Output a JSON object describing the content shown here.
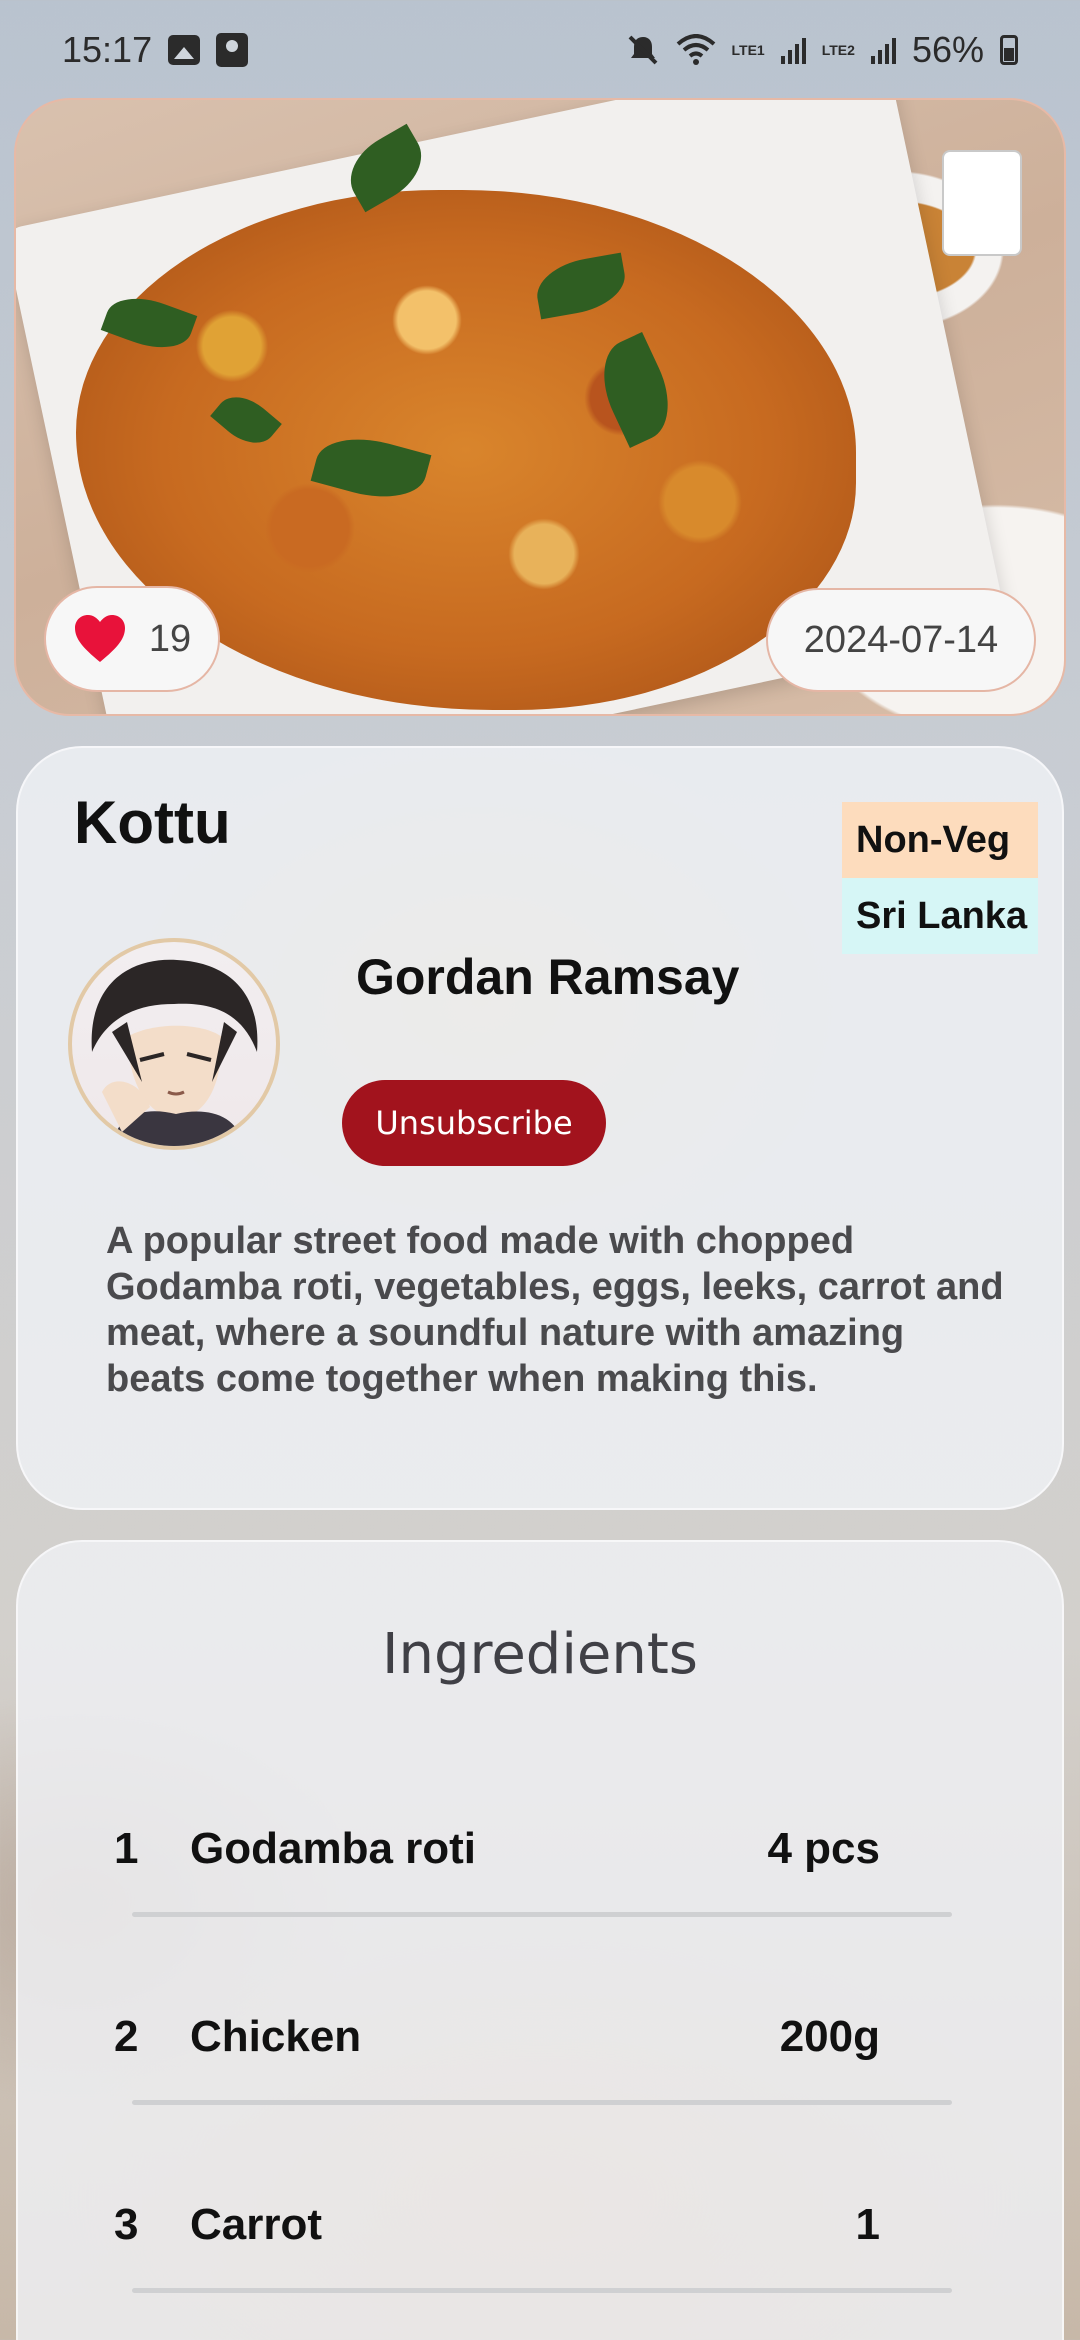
{
  "status_bar": {
    "time": "15:17",
    "sim1": "LTE1",
    "sim2": "LTE2",
    "battery": "56%",
    "icons": [
      "gallery-icon",
      "contact-icon",
      "mute-icon",
      "wifi-icon",
      "signal-icon",
      "battery-icon"
    ]
  },
  "hero": {
    "likes": "19",
    "date": "2024-07-14",
    "heart_color": "#e8123a"
  },
  "recipe": {
    "title": "Kottu",
    "tags": {
      "type": "Non-Veg",
      "region": "Sri Lanka"
    },
    "chef": "Gordan Ramsay",
    "unsubscribe_label": "Unsubscribe",
    "description": "A popular street food made with chopped Godamba roti, vegetables, eggs, leeks, carrot and meat, where a soundful nature with amazing beats come together when making this."
  },
  "ingredients": {
    "title": "Ingredients",
    "items": [
      {
        "num": "1",
        "name": "Godamba roti",
        "qty": "4 pcs"
      },
      {
        "num": "2",
        "name": "Chicken",
        "qty": "200g"
      },
      {
        "num": "3",
        "name": "Carrot",
        "qty": "1"
      }
    ]
  },
  "colors": {
    "accent": "#a2131d",
    "tag_type_bg": "#fddcbd",
    "tag_region_bg": "#d6f6f6"
  }
}
